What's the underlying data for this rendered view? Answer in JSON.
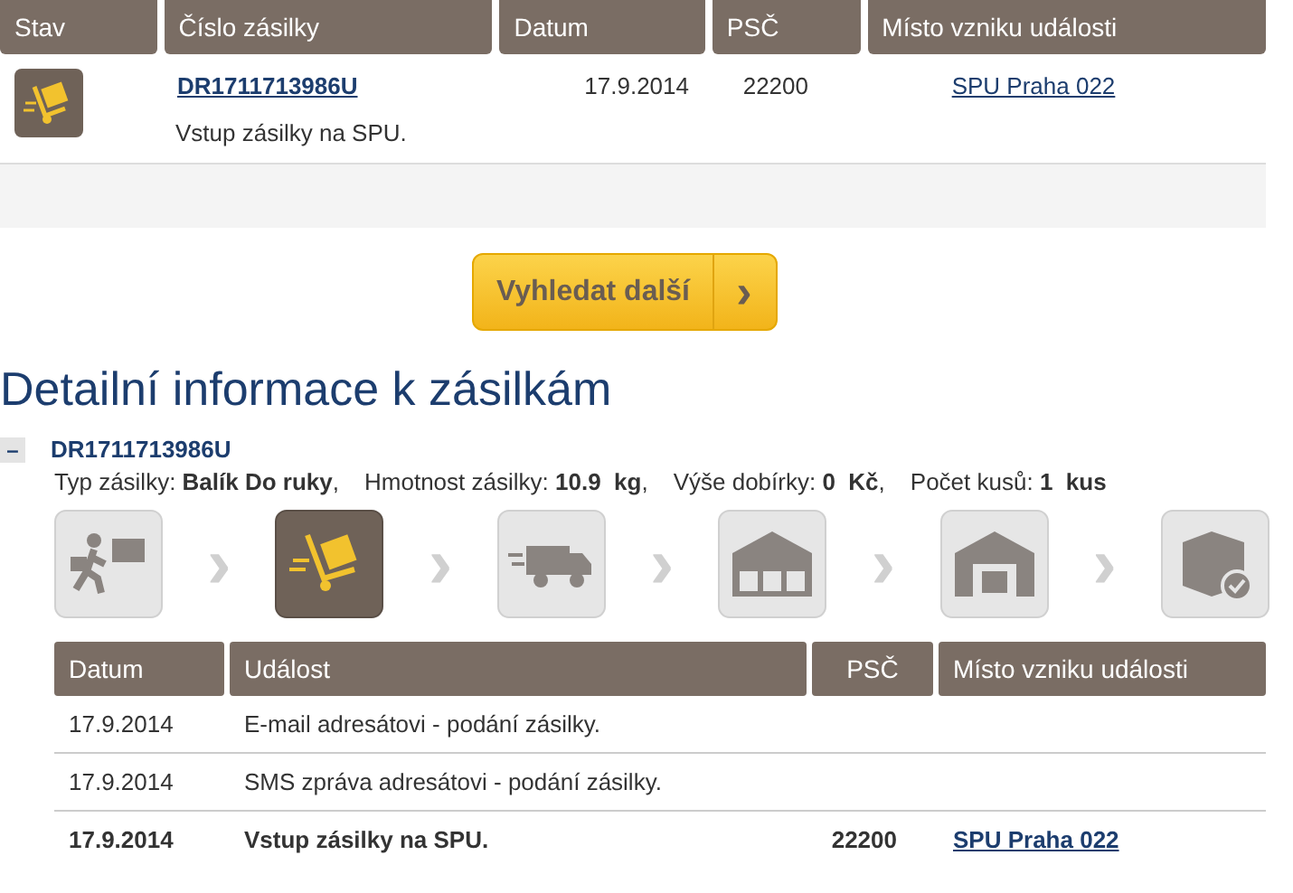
{
  "results": {
    "columns": [
      "Stav",
      "Číslo zásilky",
      "Datum",
      "PSČ",
      "Místo vzniku události"
    ],
    "rows": [
      {
        "kind": "cart",
        "number": "DR1711713986U",
        "date": "17.9.2014",
        "psc": "22200",
        "place": "SPU Praha 022",
        "description": "Vstup zásilky na SPU."
      }
    ]
  },
  "search_more_button": {
    "label": "Vyhledat další",
    "arrow": "›"
  },
  "detail": {
    "heading": "Detailní informace k zásilkám",
    "parcel": {
      "expanded": true,
      "collapse_symbol": "–",
      "number": "DR1711713986U",
      "info": [
        "Typ zásilky: **Balík Do ruky**,",
        "Hmotnost zásilky: **10.9  kg**,",
        "Výše dobírky: **0  Kč**,",
        "Počet kusů: **1  kus**"
      ],
      "steps": [
        {
          "kind": "handover",
          "selected": false
        },
        {
          "kind": "cart",
          "selected": true
        },
        {
          "kind": "truck",
          "selected": false
        },
        {
          "kind": "depot",
          "selected": false
        },
        {
          "kind": "warehouse",
          "selected": false
        },
        {
          "kind": "delivered",
          "selected": false
        }
      ],
      "step_arrow": "›",
      "events": {
        "columns": [
          "Datum",
          "Událost",
          "PSČ",
          "Místo vzniku události"
        ],
        "rows": [
          {
            "highlighted": false,
            "date": "17.9.2014",
            "event": "E-mail adresátovi - podání zásilky."
          },
          {
            "highlighted": false,
            "date": "17.9.2014",
            "event": "SMS zpráva adresátovi - podání zásilky."
          },
          {
            "highlighted": true,
            "date": "17.9.2014",
            "event": "Vstup zásilky na SPU.",
            "psc": "22200",
            "place": "SPU Praha 022"
          }
        ]
      }
    }
  }
}
